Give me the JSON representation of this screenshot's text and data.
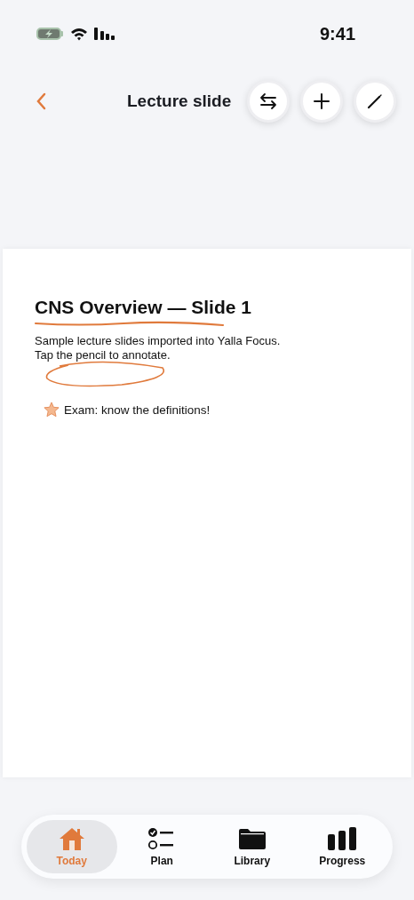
{
  "status_bar": {
    "time": "9:41"
  },
  "nav": {
    "title": "Lecture slide"
  },
  "slide": {
    "title": "CNS Overview — Slide 1",
    "lines": [
      "Sample lecture slides imported into Yalla Focus.",
      "Tap the pencil to annotate."
    ],
    "note": "Exam: know the definitions!"
  },
  "tabs": [
    {
      "label": "Today",
      "selected": true
    },
    {
      "label": "Plan",
      "selected": false
    },
    {
      "label": "Library",
      "selected": false
    },
    {
      "label": "Progress",
      "selected": false
    }
  ]
}
